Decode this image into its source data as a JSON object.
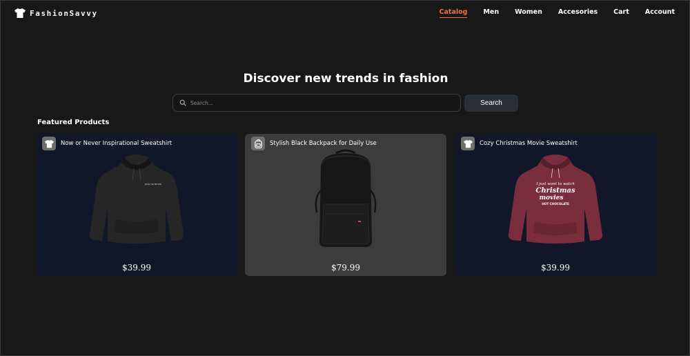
{
  "brand": {
    "name": "FashionSavvy",
    "logo_icon": "tshirt-icon"
  },
  "nav": {
    "items": [
      {
        "label": "Catalog",
        "active": true
      },
      {
        "label": "Men"
      },
      {
        "label": "Women"
      },
      {
        "label": "Accesories"
      },
      {
        "label": "Cart"
      },
      {
        "label": "Account"
      }
    ]
  },
  "hero": {
    "title": "Discover new trends in fashion"
  },
  "search": {
    "placeholder": "Search...",
    "value": "",
    "button_label": "Search",
    "icon": "search-icon"
  },
  "featured": {
    "title": "Featured Products",
    "products": [
      {
        "name": "Now or Never Inspirational Sweatshirt",
        "price": "$39.99",
        "badge_icon": "tshirt-icon",
        "bg": "#111728",
        "image": "black-hoodie",
        "print_text": "NOW OR NEVER"
      },
      {
        "name": "Stylish Black Backpack for Daily Use",
        "price": "$79.99",
        "badge_icon": "bag-icon",
        "bg": "#3c3c3c",
        "image": "black-backpack"
      },
      {
        "name": "Cozy Christmas Movie Sweatshirt",
        "price": "$39.99",
        "badge_icon": "tshirt-icon",
        "bg": "#111728",
        "image": "maroon-hoodie",
        "print_text": [
          "I just want to watch",
          "Christmas",
          "movies",
          "HOT CHOCOLATE"
        ]
      }
    ]
  },
  "colors": {
    "accent": "#e8734a",
    "background": "#181818",
    "card_navy": "#111728",
    "card_gray": "#3c3c3c",
    "button": "#2a2f3a"
  }
}
